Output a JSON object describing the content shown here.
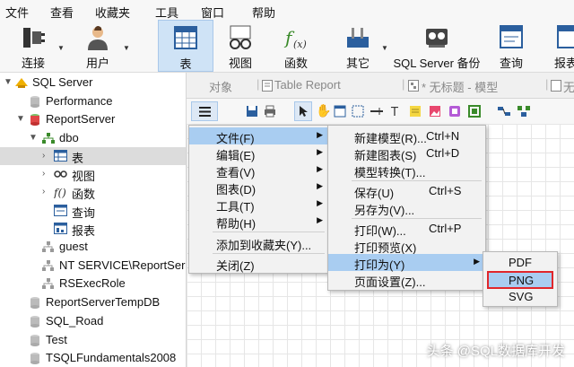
{
  "menubar": [
    "文件",
    "查看",
    "收藏夹",
    "工具",
    "窗口",
    "帮助"
  ],
  "toolbar": [
    {
      "label": "连接",
      "icon": "plug-icon"
    },
    {
      "label": "用户",
      "icon": "user-icon"
    },
    {
      "label": "表",
      "icon": "table-icon",
      "active": true
    },
    {
      "label": "视图",
      "icon": "glasses-icon"
    },
    {
      "label": "函数",
      "icon": "function-icon"
    },
    {
      "label": "其它",
      "icon": "tools-icon"
    },
    {
      "label": "SQL Server 备份",
      "icon": "backup-icon"
    },
    {
      "label": "查询",
      "icon": "query-icon"
    },
    {
      "label": "报表",
      "icon": "report-icon"
    }
  ],
  "tree": [
    {
      "label": "SQL Server"
    },
    {
      "label": "Performance"
    },
    {
      "label": "ReportServer"
    },
    {
      "label": "dbo"
    },
    {
      "label": "表"
    },
    {
      "label": "视图"
    },
    {
      "label": "函数"
    },
    {
      "label": "查询"
    },
    {
      "label": "报表"
    },
    {
      "label": "guest"
    },
    {
      "label": "NT SERVICE\\ReportSer"
    },
    {
      "label": "RSExecRole"
    },
    {
      "label": "ReportServerTempDB"
    },
    {
      "label": "SQL_Road"
    },
    {
      "label": "Test"
    },
    {
      "label": "TSQLFundamentals2008"
    }
  ],
  "tabs": [
    "对象",
    "Table Report",
    "* 无标题 - 模型",
    "无"
  ],
  "main_menu": [
    {
      "label": "文件(F)"
    },
    {
      "label": "编辑(E)"
    },
    {
      "label": "查看(V)"
    },
    {
      "label": "图表(D)"
    },
    {
      "label": "工具(T)"
    },
    {
      "label": "帮助(H)"
    },
    {
      "label": "添加到收藏夹(Y)..."
    },
    {
      "label": "关闭(Z)"
    }
  ],
  "file_menu": [
    {
      "label": "新建模型(R)...",
      "key": "Ctrl+N"
    },
    {
      "label": "新建图表(S)",
      "key": "Ctrl+D"
    },
    {
      "label": "模型转换(T)...",
      "key": ""
    },
    {
      "label": "保存(U)",
      "key": "Ctrl+S"
    },
    {
      "label": "另存为(V)...",
      "key": ""
    },
    {
      "label": "打印(W)...",
      "key": "Ctrl+P"
    },
    {
      "label": "打印预览(X)",
      "key": ""
    },
    {
      "label": "打印为(Y)",
      "key": ""
    },
    {
      "label": "页面设置(Z)...",
      "key": ""
    }
  ],
  "print_as_menu": [
    "PDF",
    "PNG",
    "SVG"
  ],
  "watermark": "头条 @SQL数据库开发",
  "colors": {
    "highlight": "#a9cdf1",
    "toolbar_active": "#cfe3f6",
    "red_box": "#e0262b"
  }
}
